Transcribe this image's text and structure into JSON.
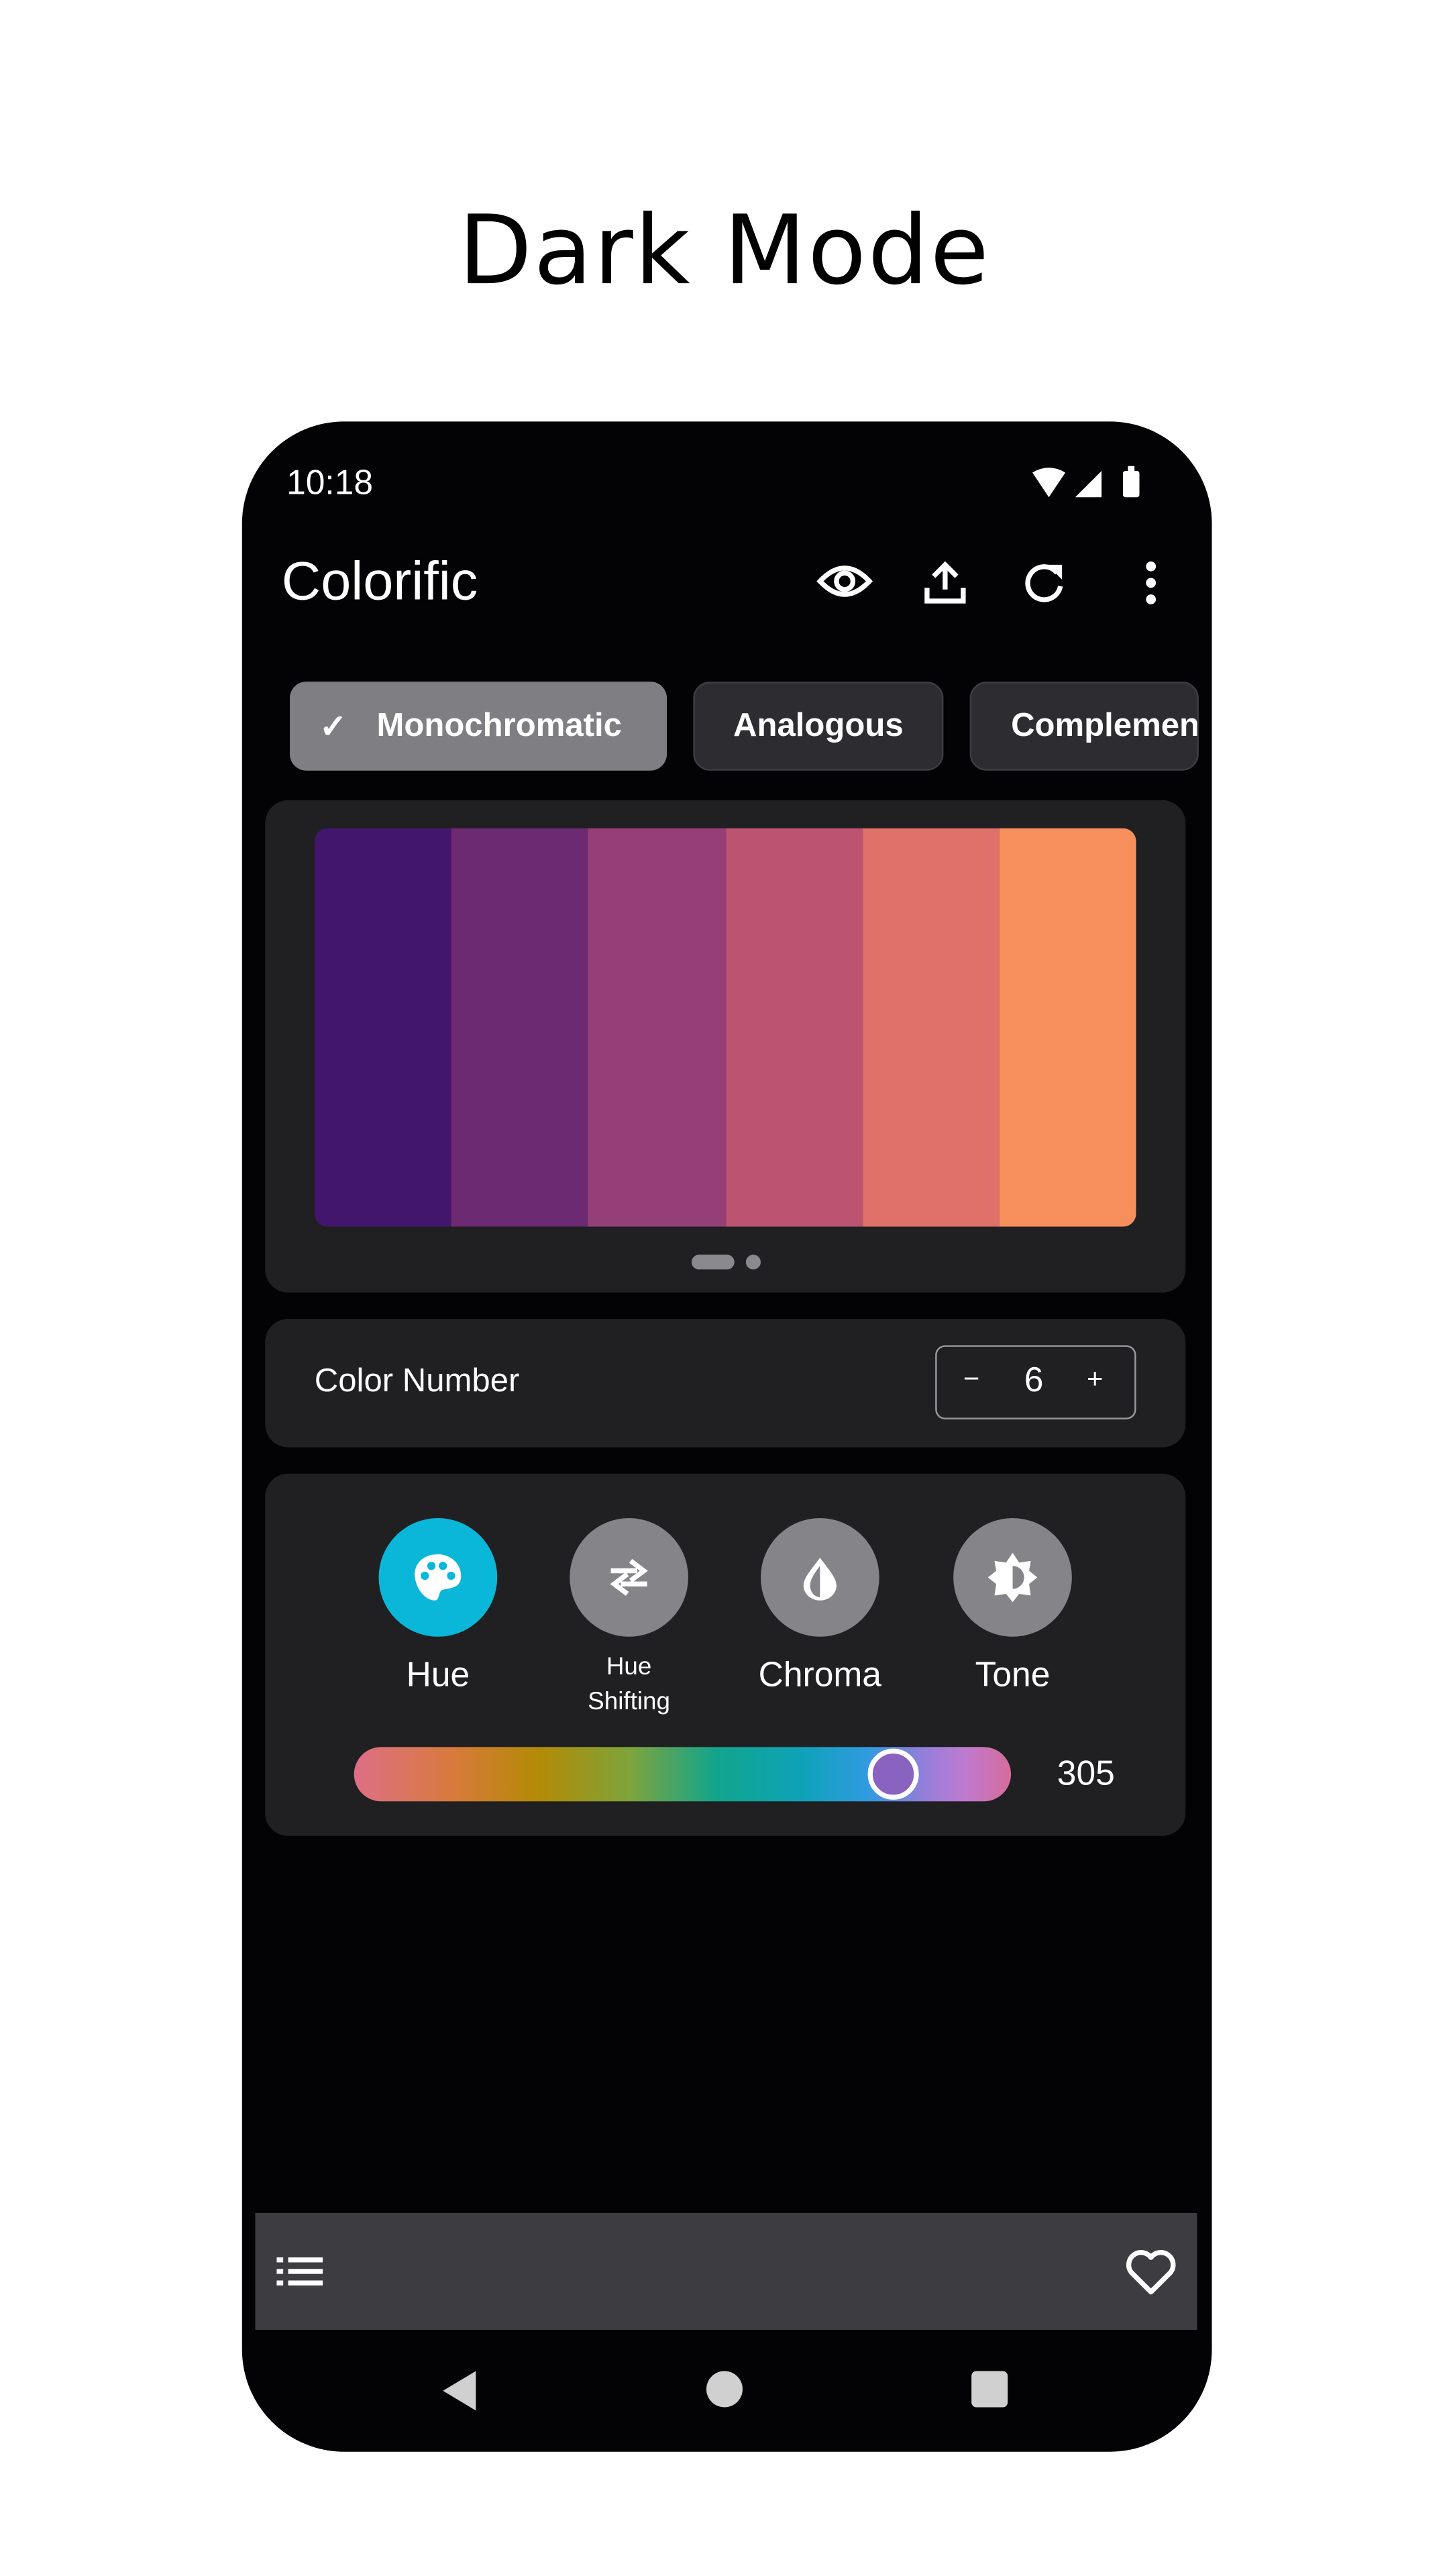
{
  "headline": "Dark Mode",
  "status_bar": {
    "time": "10:18"
  },
  "app_bar": {
    "title": "Colorific",
    "icons": [
      "eye-icon",
      "share-upload-icon",
      "refresh-icon",
      "more-vert-icon"
    ]
  },
  "schemes": [
    {
      "label": "Monochromatic",
      "selected": true
    },
    {
      "label": "Analogous",
      "selected": false
    },
    {
      "label": "Complementary",
      "visible_text": "Complemen",
      "selected": false
    }
  ],
  "palette": {
    "colors": [
      "#42166d",
      "#6b2a72",
      "#963f77",
      "#bb5371",
      "#e0706a",
      "#f78f5c"
    ],
    "page": 1,
    "pages": 2
  },
  "color_number": {
    "label": "Color Number",
    "value": "6",
    "minus": "−",
    "plus": "+"
  },
  "modes": [
    {
      "label": "Hue",
      "icon": "palette-icon",
      "active": true
    },
    {
      "label": "Hue Shifting",
      "line1": "Hue",
      "line2": "Shifting",
      "icon": "swap-icon",
      "active": false
    },
    {
      "label": "Chroma",
      "icon": "drop-icon",
      "active": false
    },
    {
      "label": "Tone",
      "icon": "brightness-icon",
      "active": false
    }
  ],
  "slider": {
    "value": "305",
    "min": 0,
    "max": 360,
    "thumb_color": "#8a63c0"
  },
  "colors": {
    "accent": "#0bb7d8",
    "background": "#030204",
    "card": "#201f22",
    "bottom_bar": "#3d3c40"
  },
  "bottom_bar": {
    "icons": [
      "list-icon",
      "heart-icon"
    ]
  },
  "nav": {
    "icons": [
      "back-icon",
      "home-icon",
      "recents-icon"
    ]
  }
}
